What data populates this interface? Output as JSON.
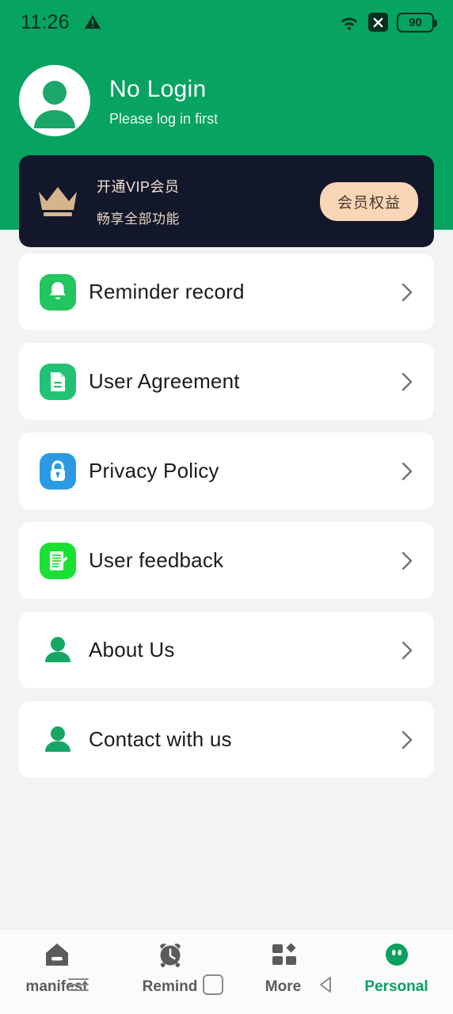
{
  "status_bar": {
    "time": "11:26",
    "warning_icon": "warning-triangle-icon",
    "wifi_icon": "wifi-icon",
    "x_icon": "x-badge-icon",
    "battery_level": "90"
  },
  "profile": {
    "avatar_icon": "user-avatar-icon",
    "name": "No Login",
    "subtitle": "Please log in first"
  },
  "vip_banner": {
    "crown_icon": "crown-icon",
    "title": "开通VIP会员",
    "subtitle": "畅享全部功能",
    "button_label": "会员权益",
    "background_color": "#12172b",
    "button_color": "#f9d6b6"
  },
  "menu": {
    "items": [
      {
        "label": "Reminder record",
        "icon": "bell-icon",
        "icon_style": "square",
        "icon_color": "#22c55e",
        "chevron": "chevron-right-icon"
      },
      {
        "label": "User Agreement",
        "icon": "document-icon",
        "icon_style": "square",
        "icon_color": "#21c274",
        "chevron": "chevron-right-icon"
      },
      {
        "label": "Privacy Policy",
        "icon": "lock-icon",
        "icon_style": "square",
        "icon_color": "#2b9ae3",
        "chevron": "chevron-right-icon"
      },
      {
        "label": "User feedback",
        "icon": "document-edit-icon",
        "icon_style": "square",
        "icon_color": "#1ae034",
        "chevron": "chevron-right-icon"
      },
      {
        "label": "About Us",
        "icon": "person-icon",
        "icon_style": "plain",
        "icon_color": "#16a765",
        "chevron": "chevron-right-icon"
      },
      {
        "label": "Contact with us",
        "icon": "person-icon",
        "icon_style": "plain",
        "icon_color": "#16a765",
        "chevron": "chevron-right-icon"
      }
    ]
  },
  "bottom_nav": {
    "items": [
      {
        "label": "manifest",
        "icon": "home-icon",
        "active": false
      },
      {
        "label": "Remind",
        "icon": "alarm-clock-icon",
        "active": false
      },
      {
        "label": "More",
        "icon": "grid-icon",
        "active": false
      },
      {
        "label": "Personal",
        "icon": "user-circle-icon",
        "active": true
      }
    ],
    "active_color": "#0aa05f",
    "inactive_color": "#5b5b5b"
  },
  "system_nav": {
    "recents_icon": "hamburger-icon",
    "home_icon": "square-icon",
    "back_icon": "triangle-back-icon"
  },
  "theme": {
    "header_green": "#07a361",
    "page_background": "#f2f3f5",
    "card_background": "#ffffff"
  }
}
